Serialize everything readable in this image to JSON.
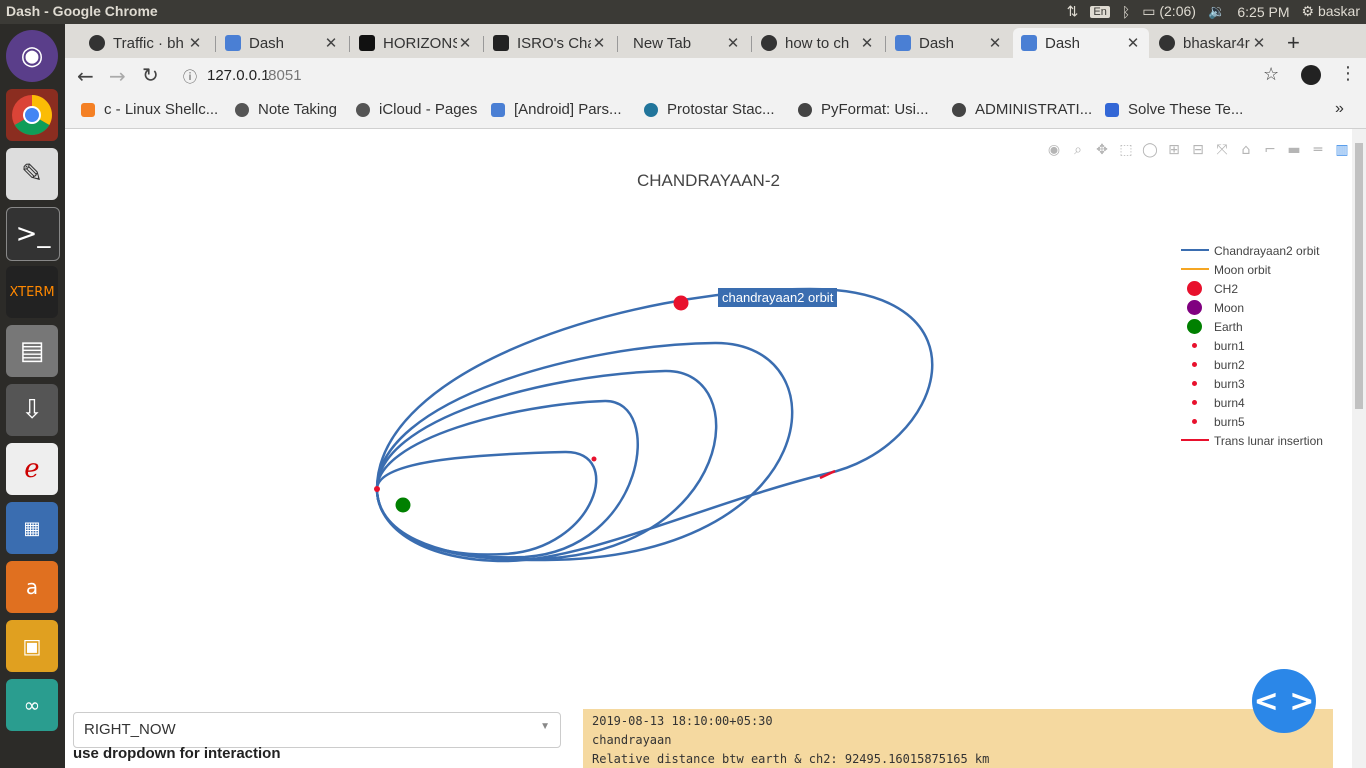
{
  "window": {
    "title": "Dash - Google Chrome"
  },
  "system_tray": {
    "lang": "En",
    "battery": "(2:06)",
    "time": "6:25 PM",
    "user": "baskar"
  },
  "tabs": [
    {
      "label": "Traffic · bh",
      "icon": "github-icon"
    },
    {
      "label": "Dash",
      "icon": "dash-icon"
    },
    {
      "label": "HORIZONS",
      "icon": "horizons-icon"
    },
    {
      "label": "ISRO's Cha",
      "icon": "quint-icon"
    },
    {
      "label": "New Tab",
      "icon": ""
    },
    {
      "label": "how to ch",
      "icon": "github-icon"
    },
    {
      "label": "Dash",
      "icon": "dash-icon"
    },
    {
      "label": "Dash",
      "icon": "dash-icon"
    },
    {
      "label": "bhaskar4r",
      "icon": "github-icon"
    }
  ],
  "address": {
    "host": "127.0.0.1",
    "port": ":8051"
  },
  "bookmarks": [
    {
      "label": "c - Linux Shellc..."
    },
    {
      "label": "Note Taking"
    },
    {
      "label": "iCloud - Pages"
    },
    {
      "label": "[Android] Pars..."
    },
    {
      "label": "Protostar Stac..."
    },
    {
      "label": "PyFormat: Usi..."
    },
    {
      "label": "ADMINISTRATI..."
    },
    {
      "label": "Solve These Te..."
    }
  ],
  "plot": {
    "title": "CHANDRAYAAN-2",
    "hover_label": "chandrayaan2 orbit",
    "legend": [
      {
        "name": "Chandrayaan2 orbit",
        "kind": "line",
        "color": "#3a6db0"
      },
      {
        "name": "Moon orbit",
        "kind": "line",
        "color": "#f5a623"
      },
      {
        "name": "CH2",
        "kind": "marker",
        "color": "#e8112d"
      },
      {
        "name": "Moon",
        "kind": "marker",
        "color": "#800080"
      },
      {
        "name": "Earth",
        "kind": "marker",
        "color": "#008000"
      },
      {
        "name": "burn1",
        "kind": "dot",
        "color": "#e8112d"
      },
      {
        "name": "burn2",
        "kind": "dot",
        "color": "#e8112d"
      },
      {
        "name": "burn3",
        "kind": "dot",
        "color": "#e8112d"
      },
      {
        "name": "burn4",
        "kind": "dot",
        "color": "#e8112d"
      },
      {
        "name": "burn5",
        "kind": "dot",
        "color": "#e8112d"
      },
      {
        "name": "Trans lunar insertion",
        "kind": "line",
        "color": "#e8112d"
      }
    ]
  },
  "controls": {
    "dropdown_value": "RIGHT_NOW",
    "hint": "use dropdown for interaction"
  },
  "info": {
    "line1": "2019-08-13 18:10:00+05:30",
    "line2": "chandrayaan",
    "line3": "Relative distance btw earth & ch2: 92495.16015875165 km"
  }
}
